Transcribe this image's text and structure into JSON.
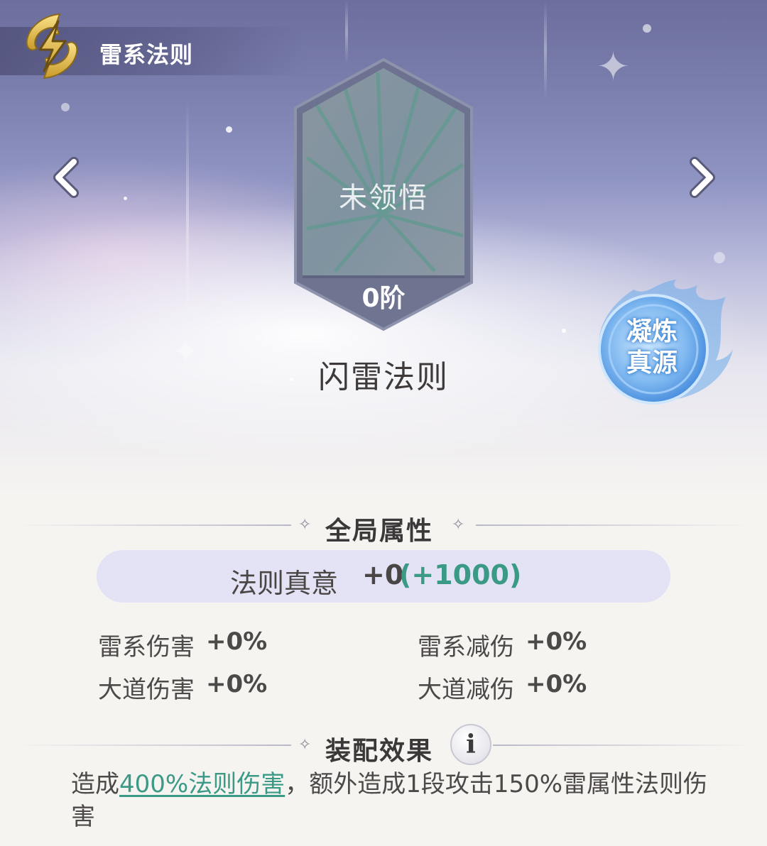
{
  "header": {
    "title": "雷系法则"
  },
  "law": {
    "status": "未领悟",
    "rank": "0阶",
    "name": "闪雷法则"
  },
  "refine_button": {
    "line1": "凝炼",
    "line2": "真源"
  },
  "global_attributes": {
    "title": "全局属性",
    "essence": {
      "label": "法则真意",
      "value": "+0",
      "bonus": "(+1000)"
    },
    "stats": [
      {
        "label": "雷系伤害",
        "value": "+0%"
      },
      {
        "label": "雷系减伤",
        "value": "+0%"
      },
      {
        "label": "大道伤害",
        "value": "+0%"
      },
      {
        "label": "大道减伤",
        "value": "+0%"
      }
    ]
  },
  "equip_effect": {
    "title": "装配效果",
    "info_icon": "i",
    "text_prefix": "造成",
    "highlight": "400%法则伤害",
    "text_suffix": "，额外造成1段攻击150%雷属性法则伤害"
  },
  "icons": {
    "emblem": "lightning-emblem-icon",
    "prev": "chevron-left-icon",
    "next": "chevron-right-icon",
    "info": "info-icon"
  },
  "colors": {
    "accent_green": "#3a9a86",
    "gold": "#e0b640",
    "flame_blue": "#4e9be6"
  }
}
